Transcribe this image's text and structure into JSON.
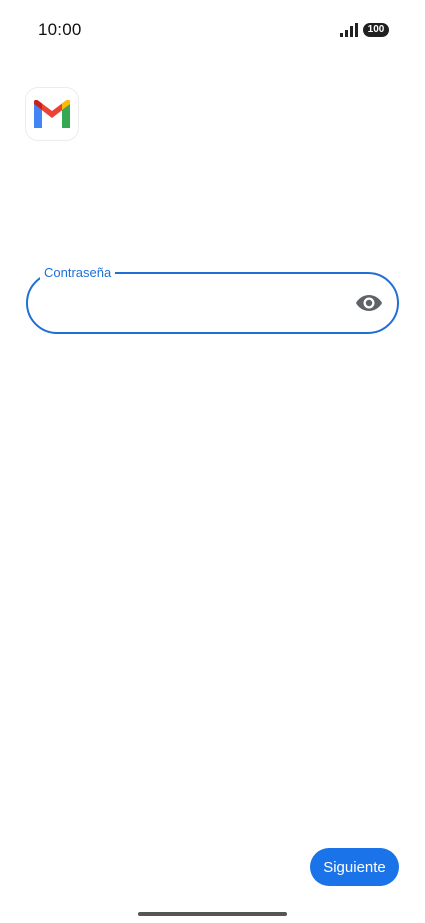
{
  "status_bar": {
    "time": "10:00",
    "battery": "100",
    "signal_icon": "signal-bars-icon"
  },
  "app": {
    "logo_icon": "gmail-logo-icon"
  },
  "password_field": {
    "label": "Contraseña",
    "value": "",
    "toggle_icon": "eye-icon"
  },
  "actions": {
    "next_label": "Siguiente"
  },
  "colors": {
    "accent": "#1a73e8",
    "field_border": "#1f6fd6"
  }
}
